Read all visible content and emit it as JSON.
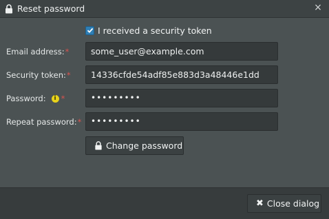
{
  "dialog": {
    "title": "Reset password",
    "close_glyph": "×"
  },
  "form": {
    "received_token": {
      "label": "I received a security token",
      "checked": true
    },
    "email": {
      "label": "Email address:",
      "required_mark": "*",
      "value": "some_user@example.com"
    },
    "security_token": {
      "label": "Security token:",
      "required_mark": "*",
      "value": "14336cfde54adf85e883d3a48446e1dd"
    },
    "password": {
      "label": "Password:",
      "required_mark": "*",
      "info_glyph": "i",
      "masked_value": "•••••••••"
    },
    "repeat_password": {
      "label": "Repeat password:",
      "required_mark": "*",
      "masked_value": "•••••••••"
    },
    "change_button": {
      "label": "Change password",
      "icon": "lock-icon"
    }
  },
  "footer": {
    "close_button": {
      "glyph": "✖",
      "label": "Close dialog",
      "icon": "close-icon"
    }
  },
  "colors": {
    "dialog_bg": "#4b5253",
    "titlebar_bg": "#3d4344",
    "footer_bg": "#373c3d",
    "input_bg": "#353a3b",
    "checkbox_accent": "#2f7fb6",
    "required": "#d9534f",
    "info": "#e8d21a"
  }
}
